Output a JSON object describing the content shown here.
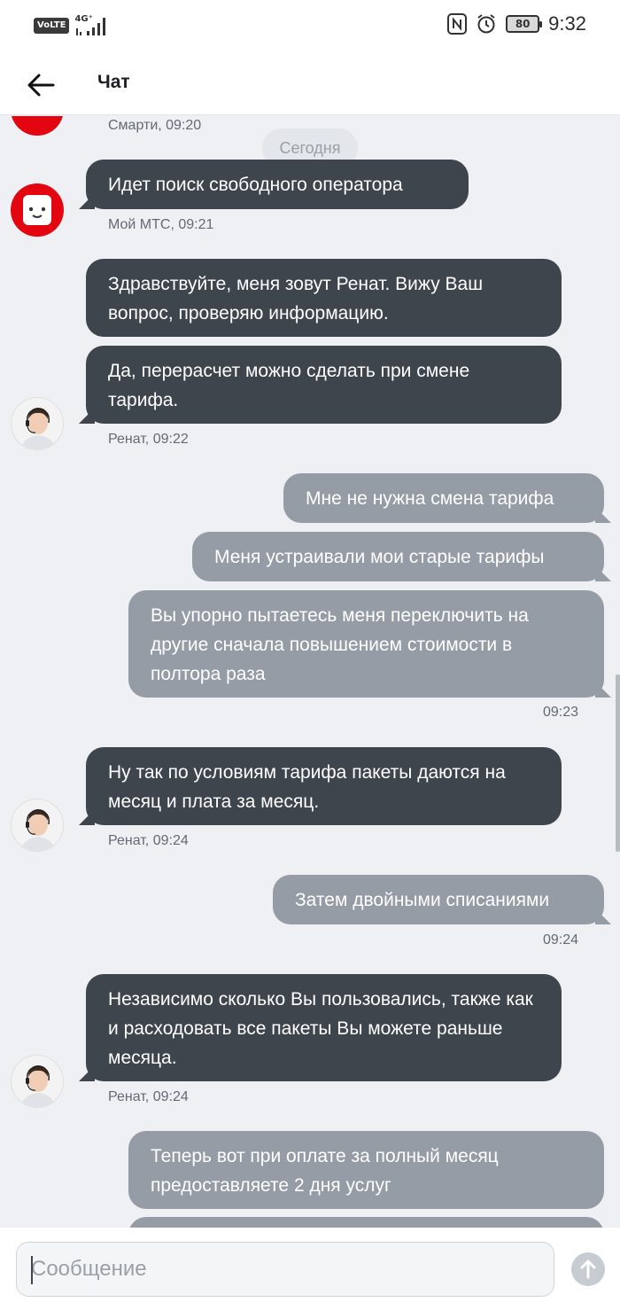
{
  "status_bar": {
    "volte": "VoLTE",
    "network": "4G⁺",
    "battery": "80",
    "time": "9:32"
  },
  "header": {
    "title": "Чат"
  },
  "chat": {
    "date_separator": "Сегодня",
    "top_meta": "Смарти, 09:20",
    "messages": [
      {
        "id": "m1",
        "text": "Идет поиск свободного оператора",
        "meta": "Мой МТС, 09:21"
      },
      {
        "id": "m2",
        "text": "Здравствуйте, меня зовут Ренат. Вижу Ваш вопрос, проверяю информацию."
      },
      {
        "id": "m3",
        "text": "Да, перерасчет можно сделать при смене тарифа.",
        "meta": "Ренат, 09:22"
      },
      {
        "id": "m4",
        "text": "Мне не нужна смена тарифа"
      },
      {
        "id": "m5",
        "text": "Меня устраивали мои старые тарифы"
      },
      {
        "id": "m6",
        "text": "Вы упорно пытаетесь меня переключить на другие сначала повышением стоимости в полтора раза",
        "meta": "09:23"
      },
      {
        "id": "m7",
        "text": "Ну так по условиям тарифа пакеты даются на месяц и плата за месяц.",
        "meta": "Ренат, 09:24"
      },
      {
        "id": "m8",
        "text": "Затем двойными списаниями",
        "meta": "09:24"
      },
      {
        "id": "m9",
        "text": "Независимо сколько Вы пользовались, также как и расходовать все пакеты Вы можете раньше месяца.",
        "meta": "Ренат, 09:24"
      },
      {
        "id": "m10",
        "text": "Теперь вот при оплате за полный месяц предоставляете 2 дня услуг"
      }
    ]
  },
  "input": {
    "placeholder": "Сообщение"
  },
  "colors": {
    "incoming": "#3f454d",
    "outgoing": "#969ca5",
    "brand": "#e30611",
    "background": "#eef0f3"
  }
}
